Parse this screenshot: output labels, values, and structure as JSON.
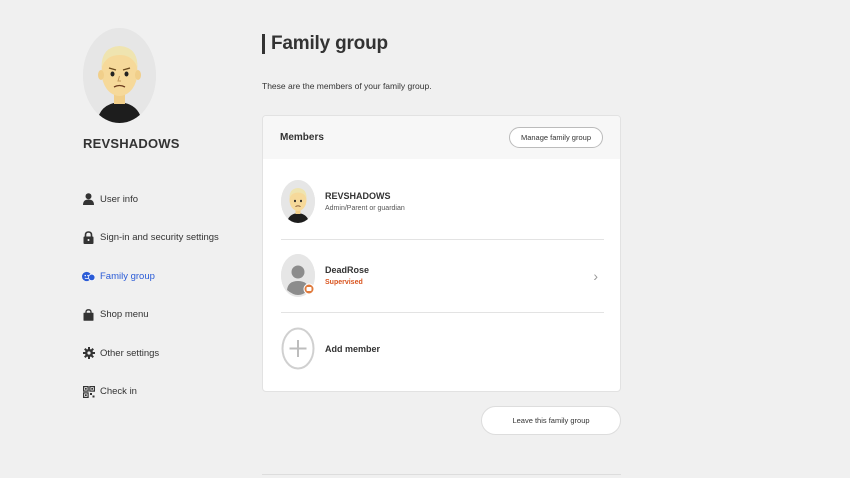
{
  "profile": {
    "username": "REVSHADOWS"
  },
  "sidebar": {
    "items": [
      {
        "label": "User info",
        "icon": "person-icon",
        "active": false
      },
      {
        "label": "Sign-in and security settings",
        "icon": "lock-icon",
        "active": false
      },
      {
        "label": "Family group",
        "icon": "family-icon",
        "active": true
      },
      {
        "label": "Shop menu",
        "icon": "bag-icon",
        "active": false
      },
      {
        "label": "Other settings",
        "icon": "gear-icon",
        "active": false
      },
      {
        "label": "Check in",
        "icon": "qr-icon",
        "active": false
      }
    ]
  },
  "main": {
    "title": "Family group",
    "subtitle": "These are the members of your family group.",
    "card": {
      "header": "Members",
      "manage_label": "Manage family group",
      "members": [
        {
          "name": "REVSHADOWS",
          "role": "Admin/Parent or guardian"
        },
        {
          "name": "DeadRose",
          "role": "Supervised"
        }
      ],
      "add_label": "Add member"
    },
    "leave_label": "Leave this family group"
  },
  "colors": {
    "accent": "#2a5bd7",
    "supervised": "#d9541e",
    "background": "#f0f0f0"
  }
}
